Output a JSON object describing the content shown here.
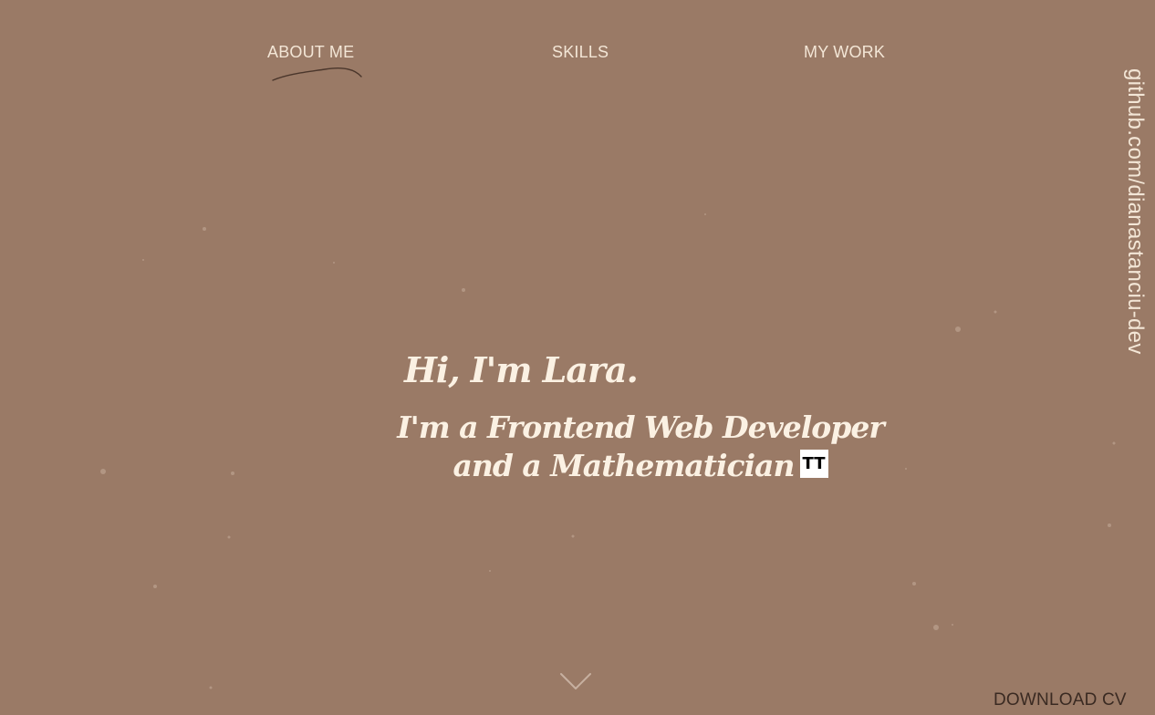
{
  "nav": {
    "items": [
      {
        "label": "ABOUT ME",
        "active": true
      },
      {
        "label": "SKILLS",
        "active": false
      },
      {
        "label": "MY WORK",
        "active": false
      }
    ]
  },
  "side_link": {
    "text": "github.com/dianastanciu-dev"
  },
  "hero": {
    "greeting": "Hi, I'm Lara.",
    "role_text": "I'm a Frontend Web Developer and a Mathematician",
    "badge_text": "TT"
  },
  "footer": {
    "download_label": "DOWNLOAD CV"
  },
  "icons": {
    "active_underline": "squiggle-underline-icon",
    "scroll": "chevron-down-icon"
  },
  "colors": {
    "background": "#9a7a66",
    "text_light": "#f3e6d6",
    "heading": "#fbf1e3",
    "download_text": "#3a2a22",
    "dots": "#b89d8b"
  }
}
